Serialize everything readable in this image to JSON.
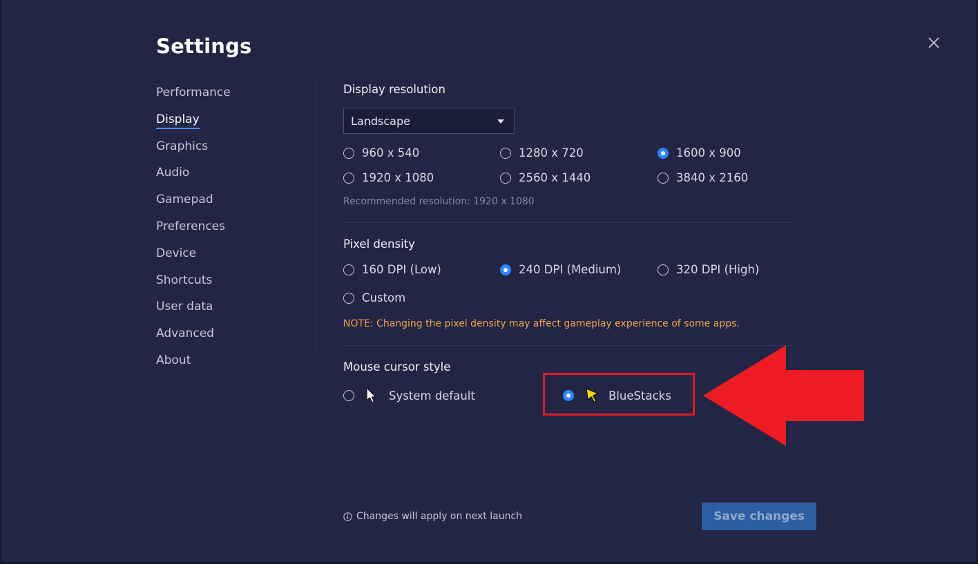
{
  "window": {
    "title": "Settings"
  },
  "nav": {
    "items": [
      {
        "label": "Performance"
      },
      {
        "label": "Display",
        "active": true
      },
      {
        "label": "Graphics"
      },
      {
        "label": "Audio"
      },
      {
        "label": "Gamepad"
      },
      {
        "label": "Preferences"
      },
      {
        "label": "Device"
      },
      {
        "label": "Shortcuts"
      },
      {
        "label": "User data"
      },
      {
        "label": "Advanced"
      },
      {
        "label": "About"
      }
    ]
  },
  "display_resolution": {
    "title": "Display resolution",
    "orientation_value": "Landscape",
    "options": [
      "960 x 540",
      "1280 x 720",
      "1600 x 900",
      "1920 x 1080",
      "2560 x 1440",
      "3840 x 2160"
    ],
    "selected": "1600 x 900",
    "recommended": "Recommended resolution: 1920 x 1080"
  },
  "pixel_density": {
    "title": "Pixel density",
    "options": [
      "160 DPI (Low)",
      "240 DPI (Medium)",
      "320 DPI (High)",
      "Custom"
    ],
    "selected": "240 DPI (Medium)",
    "note": "NOTE: Changing the pixel density may affect gameplay experience of some apps."
  },
  "mouse_cursor": {
    "title": "Mouse cursor style",
    "options": [
      "System default",
      "BlueStacks"
    ],
    "selected": "BlueStacks"
  },
  "footer": {
    "note": "Changes will apply on next launch",
    "save_label": "Save changes"
  },
  "colors": {
    "background": "#222544",
    "accent": "#2f85ff",
    "note": "#f0a44a",
    "highlight": "#e01b24",
    "save_button": "#2c5ea4"
  },
  "icons": [
    "close-icon",
    "dropdown-caret-icon",
    "system-cursor-icon",
    "bluestacks-cursor-icon",
    "info-icon",
    "red-arrow-icon"
  ]
}
